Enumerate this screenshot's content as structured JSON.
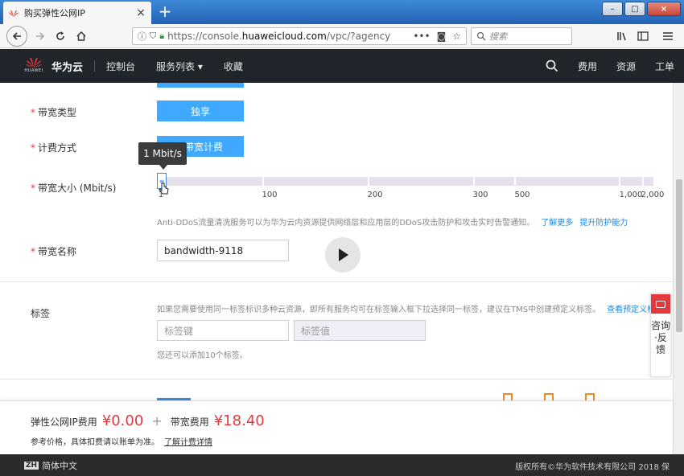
{
  "browser": {
    "tab_title": "购买弹性公网IP",
    "tab_close": "×",
    "new_tab": "+",
    "url_prefix": "https://console.",
    "url_domain": "huaweicloud.com",
    "url_suffix": "/vpc/?agency",
    "search_placeholder": "搜索",
    "window_buttons": [
      "–",
      "□",
      "×"
    ]
  },
  "header": {
    "logo_text": "HUAWEI",
    "brand": "华为云",
    "nav_console": "控制台",
    "nav_services": "服务列表 ▾",
    "nav_favorites": "收藏",
    "nav_fees": "费用",
    "nav_resources": "资源",
    "nav_tickets": "工单"
  },
  "form": {
    "bandwidth_type": {
      "label": "带宽类型",
      "value": "独享"
    },
    "billing_mode": {
      "label": "计费方式",
      "value": "按带宽计费"
    },
    "bandwidth_size": {
      "label": "带宽大小 (Mbit/s)",
      "tooltip": "1 Mbit/s",
      "value_mbit": 1,
      "ticks": [
        "1",
        "100",
        "200",
        "300",
        "500",
        "1,000",
        "2,000"
      ]
    },
    "ddos_hint": "Anti-DDoS流量清洗服务可以为华为云内资源提供网络层和应用层的DDoS攻击防护和攻击实时告警通知。",
    "ddos_link_more": "了解更多",
    "ddos_link_upgrade": "提升防护能力",
    "bandwidth_name": {
      "label": "带宽名称",
      "value": "bandwidth-9118"
    },
    "tags": {
      "label": "标签",
      "hint": "如果您需要使用同一标签标识多种云资源，即所有服务均可在标签输入框下拉选择同一标签，建议在TMS中创建预定义标签。",
      "hint_link": "查看预定义标签",
      "key_placeholder": "标签键",
      "value_placeholder": "标签值",
      "limit_note": "您还可以添加10个标签。"
    }
  },
  "consult": {
    "label": "咨询·反馈"
  },
  "fees": {
    "eip_label": "弹性公网IP费用",
    "eip_amount": "¥0.00",
    "plus": "+",
    "bandwidth_label": "带宽费用",
    "bandwidth_amount": "¥18.40",
    "note": "参考价格，具体扣费请以账单为准。",
    "note_link": "了解计费详情"
  },
  "footer": {
    "lang_badge": "ZH",
    "language": "简体中文",
    "copyright": "版权所有©华为软件技术有限公司 2018 保"
  }
}
